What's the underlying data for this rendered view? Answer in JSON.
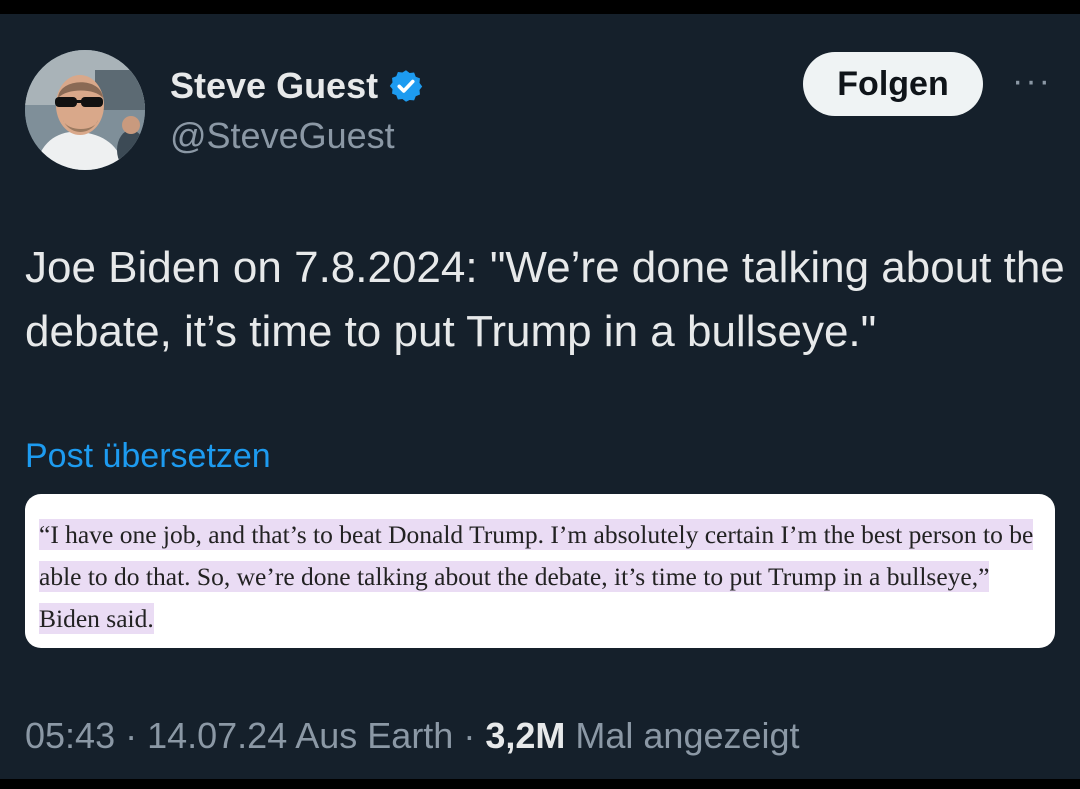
{
  "author": {
    "name": "Steve Guest",
    "handle": "@SteveGuest",
    "verified": true
  },
  "actions": {
    "follow_label": "Folgen",
    "more_label": "···"
  },
  "post": {
    "text": "Joe Biden on 7.8.2024: \"We’re done talking about the debate, it’s time to put Trump in a bullseye.\"",
    "translate_label": "Post übersetzen",
    "quote": "“I have one job, and that’s to beat Donald Trump. I’m absolutely certain I’m the best person to be able to do that. So, we’re done talking about the debate, it’s time to put Trump in a bullseye,” Biden said."
  },
  "meta": {
    "time": "05:43",
    "sep1": " · ",
    "date": "14.07.24",
    "source": " Aus Earth",
    "sep2": " · ",
    "views": "3,2M",
    "views_label": " Mal angezeigt"
  },
  "colors": {
    "background": "#15202b",
    "accent": "#1d9bf0",
    "highlight": "#eadcf4"
  }
}
